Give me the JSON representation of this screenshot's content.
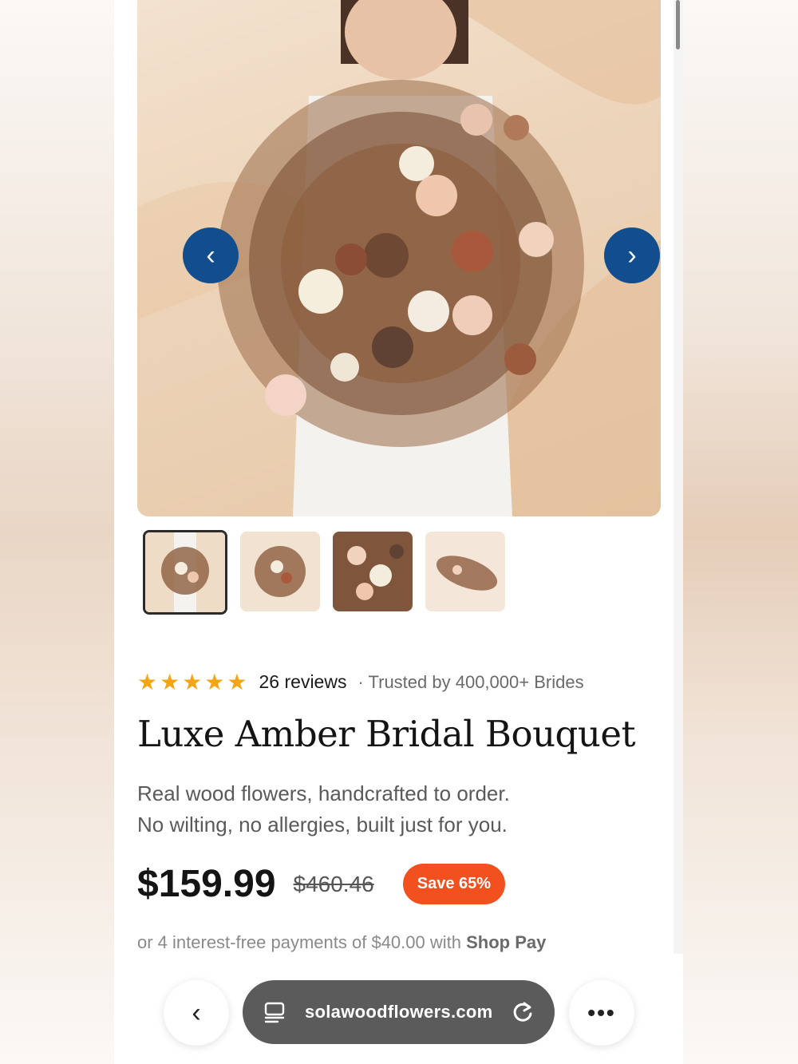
{
  "product": {
    "rating_stars": 5,
    "reviews_label": "26 reviews",
    "trusted_label": "· Trusted by 400,000+ Brides",
    "title": "Luxe Amber Bridal Bouquet",
    "description_line1": "Real wood flowers, handcrafted to order.",
    "description_line2": "No wilting, no allergies, built just for you.",
    "price": "$159.99",
    "compare_price": "$460.46",
    "save_badge": "Save 65%",
    "installments_text": "or 4 interest-free payments of $40.00 with",
    "installments_brand": "Shop Pay"
  },
  "gallery": {
    "prev_icon": "‹",
    "next_icon": "›",
    "thumbnail_count": 4,
    "active_thumbnail": 1
  },
  "browser": {
    "url": "solawoodflowers.com",
    "back_icon": "‹",
    "more_icon": "•••"
  },
  "colors": {
    "accent_nav": "#124e8e",
    "save_badge": "#f2501e",
    "stars": "#f4a516"
  }
}
